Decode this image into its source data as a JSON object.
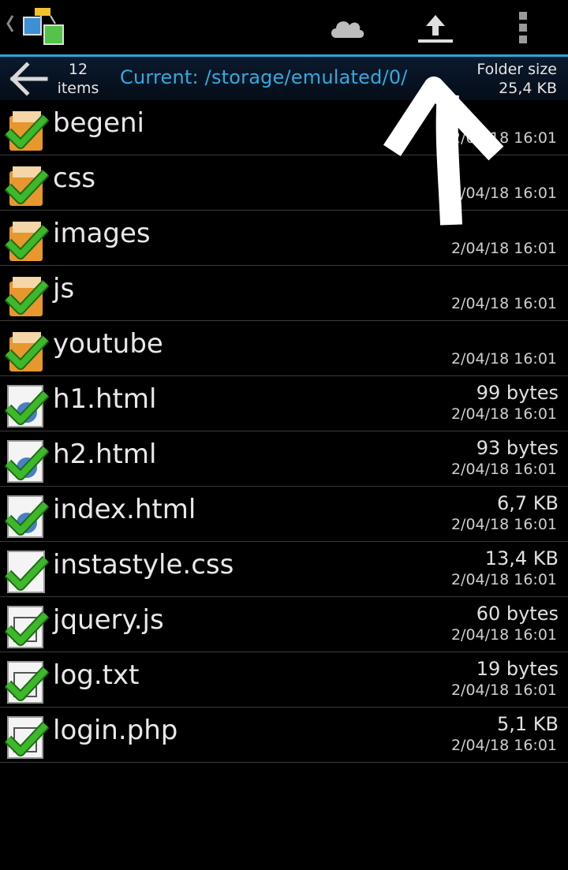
{
  "toolbar": {
    "app_icon": "app-logo-icon",
    "cloud_icon": "cloud-icon",
    "upload_icon": "upload-icon",
    "menu_icon": "overflow-menu-icon"
  },
  "pathbar": {
    "count_number": "12",
    "count_label": "items",
    "current_path": "Current: /storage/emulated/0/",
    "folder_size_label": "Folder size",
    "folder_size_value": "25,4 KB"
  },
  "files": [
    {
      "name": "begeni",
      "size": "",
      "date": "2/04/18 16:01",
      "type": "folder"
    },
    {
      "name": "css",
      "size": "",
      "date": "2/04/18 16:01",
      "type": "folder"
    },
    {
      "name": "images",
      "size": "",
      "date": "2/04/18 16:01",
      "type": "folder"
    },
    {
      "name": "js",
      "size": "",
      "date": "2/04/18 16:01",
      "type": "folder"
    },
    {
      "name": "youtube",
      "size": "",
      "date": "2/04/18 16:01",
      "type": "folder"
    },
    {
      "name": "h1.html",
      "size": "99 bytes",
      "date": "2/04/18 16:01",
      "type": "html"
    },
    {
      "name": "h2.html",
      "size": "93 bytes",
      "date": "2/04/18 16:01",
      "type": "html"
    },
    {
      "name": "index.html",
      "size": "6,7 KB",
      "date": "2/04/18 16:01",
      "type": "html"
    },
    {
      "name": "instastyle.css",
      "size": "13,4 KB",
      "date": "2/04/18 16:01",
      "type": "file"
    },
    {
      "name": "jquery.js",
      "size": "60 bytes",
      "date": "2/04/18 16:01",
      "type": "text"
    },
    {
      "name": "log.txt",
      "size": "19 bytes",
      "date": "2/04/18 16:01",
      "type": "text"
    },
    {
      "name": "login.php",
      "size": "5,1 KB",
      "date": "2/04/18 16:01",
      "type": "text"
    }
  ],
  "colors": {
    "accent": "#2fa6d6",
    "path_text": "#33aadd",
    "check": "#3cb82a",
    "folder": "#e8962e"
  }
}
